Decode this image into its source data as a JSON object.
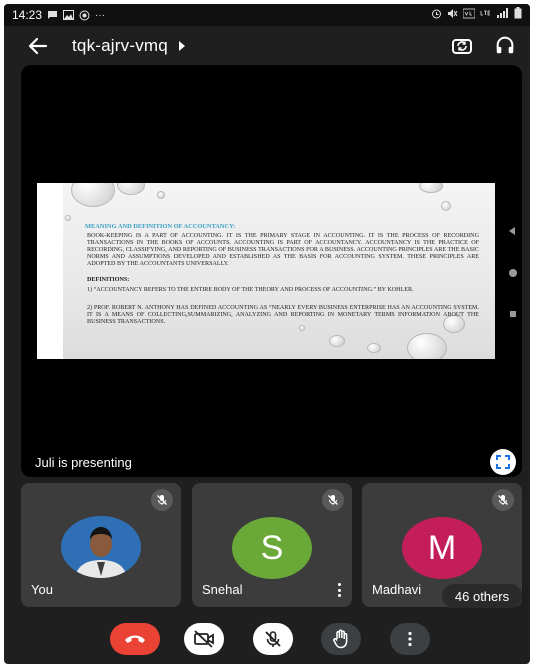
{
  "status_bar": {
    "time": "14:23",
    "left_icons": [
      "chat-icon",
      "image-icon",
      "circle-icon",
      "more-dots-icon"
    ],
    "right_icons": [
      "alarm-icon",
      "mute-icon",
      "volte-icon",
      "lte-icon",
      "signal-icon",
      "battery-icon"
    ],
    "dots": "···"
  },
  "header": {
    "meeting_code": "tqk-ajrv-vmq"
  },
  "presentation": {
    "presenter_label": "Juli is presenting",
    "slide": {
      "heading": "MEANING AND DEFINITION OF ACCOUNTANCY:",
      "paragraph_1": "BOOK-KEEPING IS A PART OF ACCOUNTING. IT IS THE PRIMARY STAGE IN ACCOUNTING. IT IS THE PROCESS OF RECORDING TRANSACTIONS IN THE BOOKS OF ACCOUNTS. ACCOUNTING IS PART OF ACCOUNTANCY. ACCOUNTANCY IS THE PRACTICE OF RECORDING, CLASSIFYING, AND REPORTING OF BUSINESS TRANSACTIONS FOR A BUSINESS. ACCOUNTING PRINCIPLES ARE THE BASIC NORMS AND ASSUMPTIONS DEVELOPED AND ESTABLISHED AS THE BASIS FOR ACCOUNTING SYSTEM. THESE PRINCIPLES ARE ADOPTED BY THE ACCOUNTANTS UNIVERSALLY.",
      "definitions_heading": "DEFINITIONS:",
      "definition_1": "1) “ACCOUNTANCY REFERS TO THE ENTIRE BODY OF THE THEORY AND PROCESS OF ACCOUNTING.” BY KOHLER.",
      "definition_2": "2) PROF. ROBERT N. ANTHONY HAS DEFINED ACCOUNTING AS “NEARLY EVERY BUSINESS ENTERPRISE HAS AN ACCOUNTING SYSTEM. IT IS A MEANS OF COLLECTING,SUMMARIZING, ANALYZING AND REPORTING IN MONETARY TERMS INFORMATION ABOUT THE BUSINESS TRANSACTIONS."
    }
  },
  "participants": [
    {
      "name": "You",
      "avatar": "photo",
      "muted": true
    },
    {
      "name": "Snehal",
      "avatar_letter": "S",
      "avatar_color": "#6aa838",
      "muted": true
    },
    {
      "name": "Madhavi",
      "avatar_letter": "M",
      "avatar_color": "#c41e5a",
      "muted": true
    }
  ],
  "others_chip": "46 others",
  "controls": {
    "end_call": {
      "icon": "phone-hangup-icon",
      "color": "#ea4335"
    },
    "camera": {
      "icon": "camera-off-icon"
    },
    "microphone": {
      "icon": "mic-off-icon"
    },
    "raise_hand": {
      "icon": "hand-icon"
    },
    "more": {
      "icon": "more-vert-icon"
    }
  }
}
